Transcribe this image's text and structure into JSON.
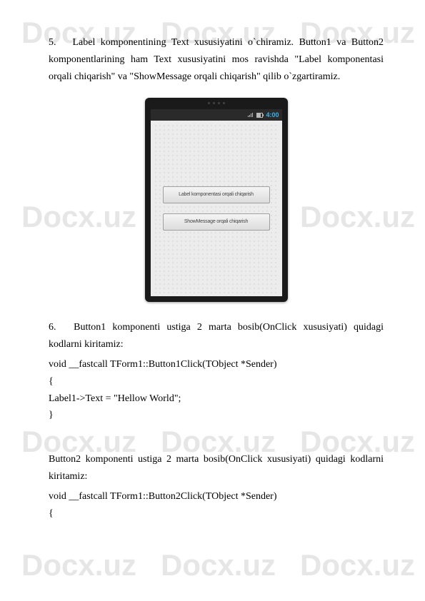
{
  "watermark": "Docx.uz",
  "section5": {
    "number": "5.",
    "text": "Label komponentining Text xususiyatini o`chiramiz. Button1 va Button2 komponentlarining ham Text xususiyatini mos ravishda \"Label komponentasi orqali chiqarish\" va \"ShowMessage orqali chiqarish\" qilib o`zgartiramiz."
  },
  "mockup": {
    "time": "4:00",
    "button1_label": "Label komponentasi orqali chiqarish",
    "button2_label": "ShowMessage orqali chiqarish"
  },
  "section6": {
    "number": "6.",
    "text": "Button1 komponenti ustiga 2 marta bosib(OnClick xususiyati) quidagi kodlarni kiritamiz:",
    "code_line1": "void __fastcall TForm1::Button1Click(TObject *Sender)",
    "code_line2": "{",
    "code_line3": "Label1->Text = \"Hellow World\";",
    "code_line4": "}"
  },
  "section_button2": {
    "text": "Button2 komponenti ustiga 2 marta bosib(OnClick xususiyati) quidagi kodlarni kiritamiz:",
    "code_line1": "void __fastcall TForm1::Button2Click(TObject *Sender)",
    "code_line2": "{"
  }
}
